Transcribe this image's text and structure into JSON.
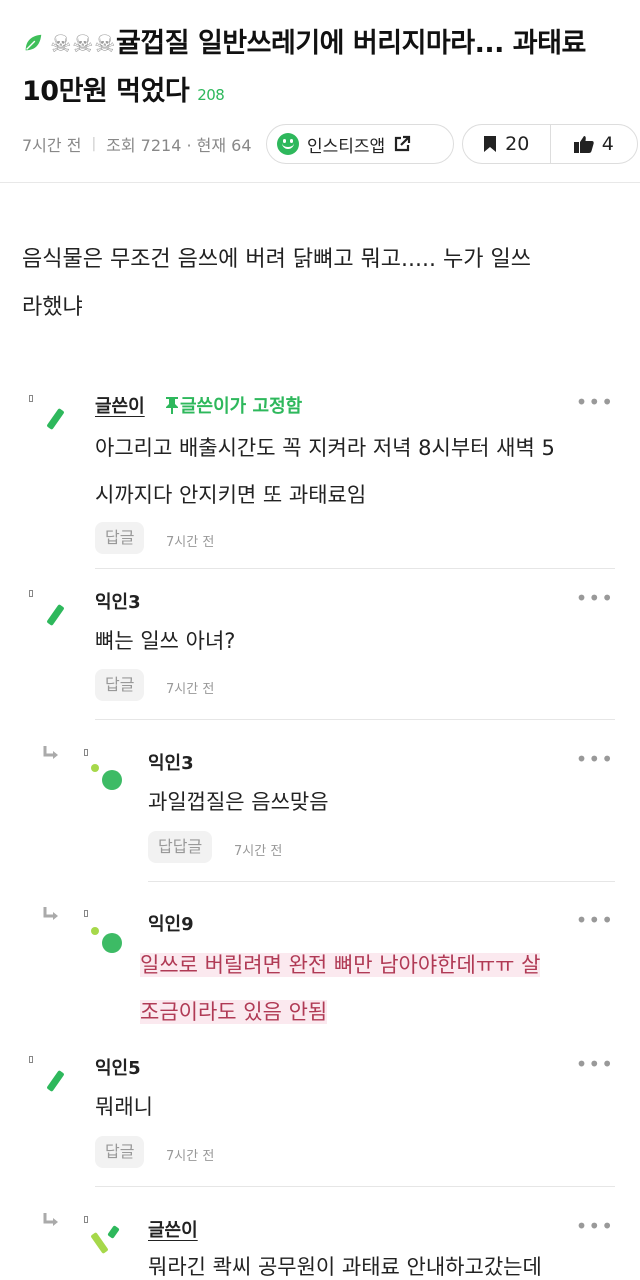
{
  "post": {
    "title_main": "귤껍질 일반쓰레기에 버리지마라... 과태료 10만원 먹었다",
    "title_count": "208",
    "time": "7시간 전",
    "views_label": "조회 7214 · 현재 64",
    "app_label": "인스티즈앱",
    "bookmark_count": "20",
    "like_count": "4",
    "body_line1": "음식물은 무조건 음쓰에 버려 닭뼈고 뭐고..... 누가 일쓰",
    "body_line2": "라했냐"
  },
  "comments": [
    {
      "name": "글쓴이",
      "pinned": "글쓴이가 고정함",
      "line1": "아그리고 배출시간도 꼭 지켜라 저녁 8시부터 새벽 5",
      "line2": "시까지다 안지키면 또 과태료임",
      "reply": "답글",
      "time": "7시간 전"
    },
    {
      "name": "익인3",
      "line1": "뼈는 일쓰 아녀?",
      "reply": "답글",
      "time": "7시간 전"
    },
    {
      "name": "익인3",
      "line1": "과일껍질은 음쓰맞음",
      "reply": "답답글",
      "time": "7시간 전"
    },
    {
      "name": "익인9",
      "line1": "일쓰로 버릴려면 완전 뼈만 남아야한데ㅠㅠ 살",
      "line2": "조금이라도 있음 안됨"
    },
    {
      "name": "익인5",
      "line1": "뭐래니",
      "reply": "답글",
      "time": "7시간 전"
    },
    {
      "name": "글쓴이",
      "line1": "뭐라긴 콱씨 공무원이 과태료 안내하고갔는데"
    }
  ],
  "colors": {
    "accent": "#2eb85c",
    "highlight_bg": "#fbe9ef",
    "highlight_text": "#b03a55"
  },
  "icons": [
    "leaf-icon",
    "skull-icon",
    "smile-icon",
    "external-link-icon",
    "bookmark-icon",
    "thumbs-up-icon",
    "pin-icon",
    "more-dots-icon",
    "reply-arrow-icon"
  ]
}
